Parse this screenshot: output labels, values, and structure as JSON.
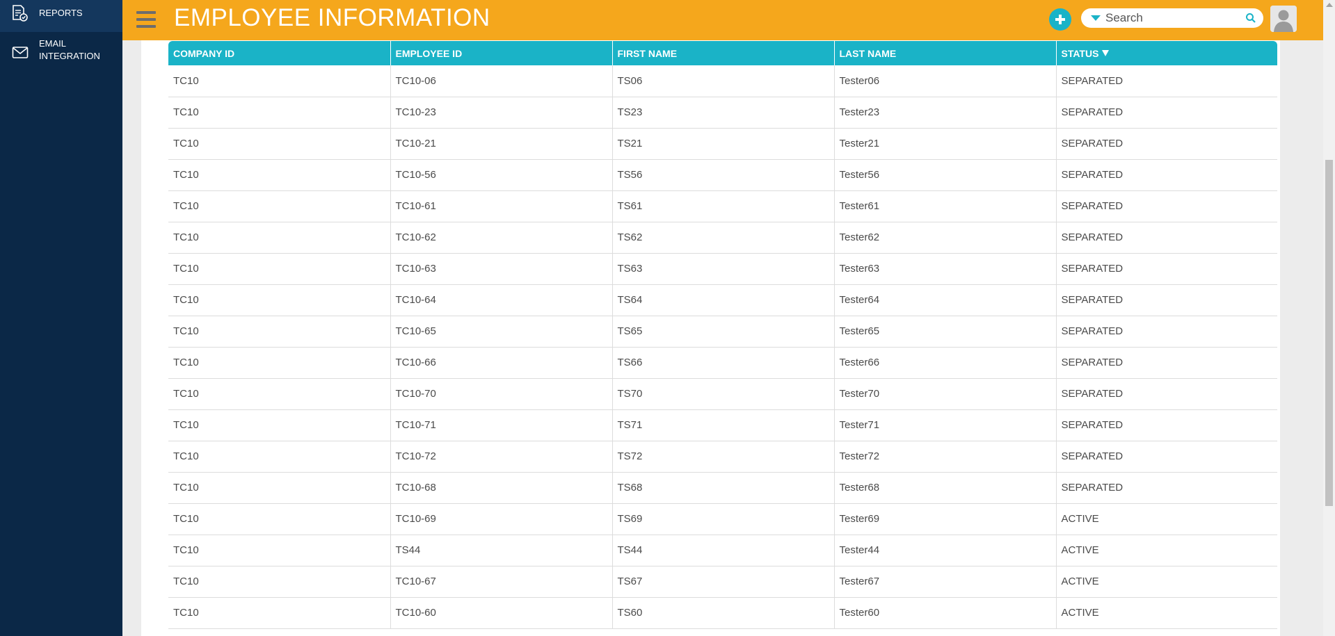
{
  "sidebar": {
    "items": [
      {
        "label": "REPORTS",
        "icon": "report-icon"
      },
      {
        "label": "EMAIL\nINTEGRATION",
        "icon": "envelope-icon"
      }
    ]
  },
  "header": {
    "title": "EMPLOYEE INFORMATION",
    "search_placeholder": "Search"
  },
  "colors": {
    "header_bg": "#f5a71c",
    "sidebar_bg": "#0b2847",
    "accent": "#1ab3c7"
  },
  "table": {
    "columns": [
      "COMPANY ID",
      "EMPLOYEE ID",
      "FIRST NAME",
      "LAST NAME",
      "STATUS"
    ],
    "sorted_column": "STATUS",
    "rows": [
      [
        "TC10",
        "TC10-06",
        "TS06",
        "Tester06",
        "SEPARATED"
      ],
      [
        "TC10",
        "TC10-23",
        "TS23",
        "Tester23",
        "SEPARATED"
      ],
      [
        "TC10",
        "TC10-21",
        "TS21",
        "Tester21",
        "SEPARATED"
      ],
      [
        "TC10",
        "TC10-56",
        "TS56",
        "Tester56",
        "SEPARATED"
      ],
      [
        "TC10",
        "TC10-61",
        "TS61",
        "Tester61",
        "SEPARATED"
      ],
      [
        "TC10",
        "TC10-62",
        "TS62",
        "Tester62",
        "SEPARATED"
      ],
      [
        "TC10",
        "TC10-63",
        "TS63",
        "Tester63",
        "SEPARATED"
      ],
      [
        "TC10",
        "TC10-64",
        "TS64",
        "Tester64",
        "SEPARATED"
      ],
      [
        "TC10",
        "TC10-65",
        "TS65",
        "Tester65",
        "SEPARATED"
      ],
      [
        "TC10",
        "TC10-66",
        "TS66",
        "Tester66",
        "SEPARATED"
      ],
      [
        "TC10",
        "TC10-70",
        "TS70",
        "Tester70",
        "SEPARATED"
      ],
      [
        "TC10",
        "TC10-71",
        "TS71",
        "Tester71",
        "SEPARATED"
      ],
      [
        "TC10",
        "TC10-72",
        "TS72",
        "Tester72",
        "SEPARATED"
      ],
      [
        "TC10",
        "TC10-68",
        "TS68",
        "Tester68",
        "SEPARATED"
      ],
      [
        "TC10",
        "TC10-69",
        "TS69",
        "Tester69",
        "ACTIVE"
      ],
      [
        "TC10",
        "TS44",
        "TS44",
        "Tester44",
        "ACTIVE"
      ],
      [
        "TC10",
        "TC10-67",
        "TS67",
        "Tester67",
        "ACTIVE"
      ],
      [
        "TC10",
        "TC10-60",
        "TS60",
        "Tester60",
        "ACTIVE"
      ]
    ]
  }
}
